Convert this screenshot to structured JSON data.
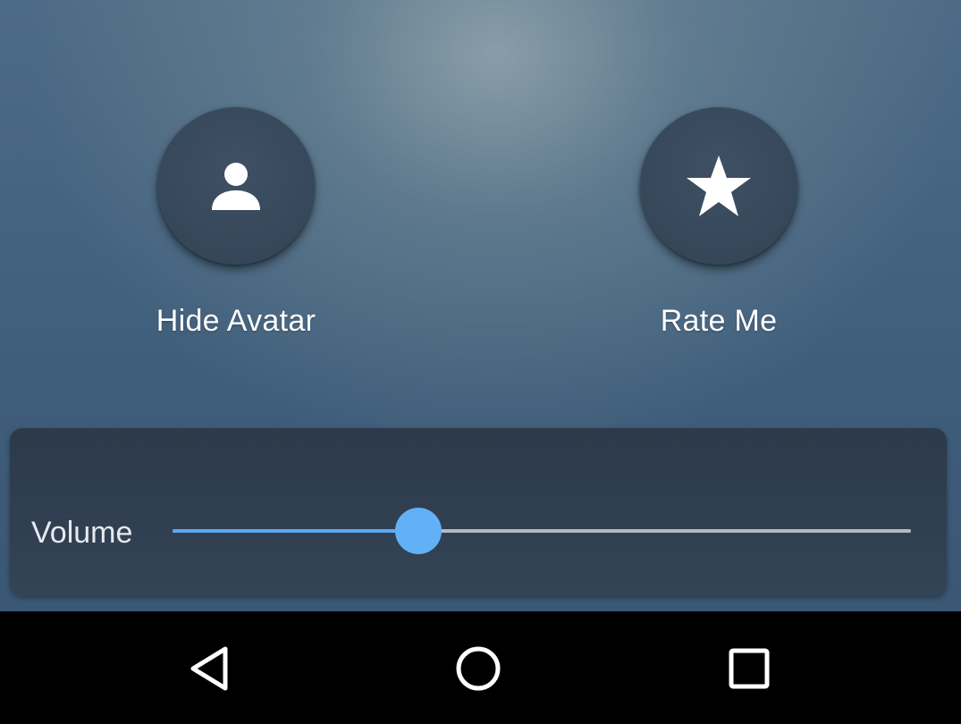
{
  "actions": {
    "hide_avatar": {
      "label": "Hide Avatar",
      "icon": "person-icon"
    },
    "rate_me": {
      "label": "Rate Me",
      "icon": "star-icon"
    }
  },
  "volume": {
    "label": "Volume",
    "value_fraction": 0.333
  },
  "nav_bar": {
    "back_icon": "back-triangle-icon",
    "home_icon": "home-circle-icon",
    "recents_icon": "recents-square-icon"
  },
  "colors": {
    "accent": "#62b1f6",
    "slider_track": "#b4b9be",
    "button_bg": "#36475a",
    "panel_bg": "#2f3e4f",
    "nav_bar_bg": "#000000",
    "text": "#ffffff"
  }
}
